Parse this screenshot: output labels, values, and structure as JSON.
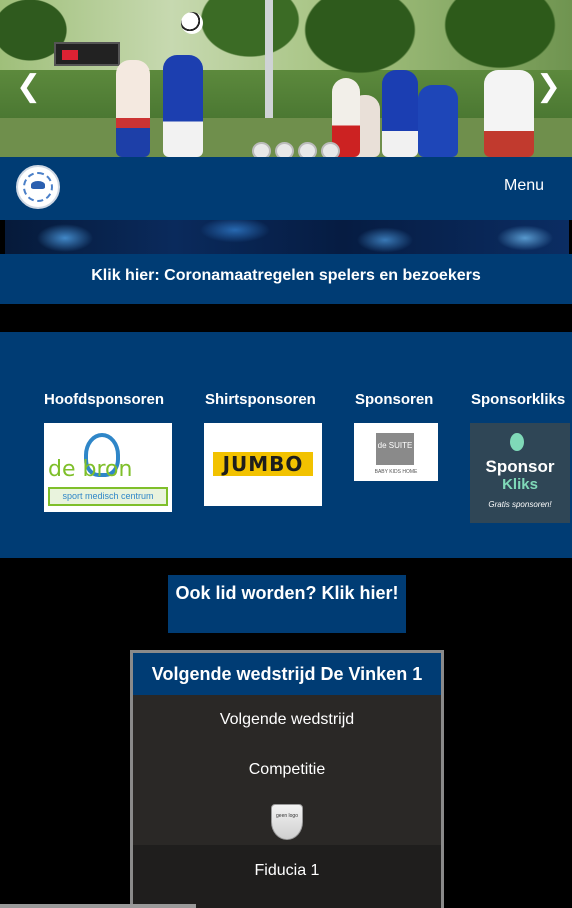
{
  "slider": {
    "prev_icon": "chevron-left-icon",
    "next_icon": "chevron-right-icon",
    "prev_glyph": "❮",
    "next_glyph": "❯",
    "dots_count": 4
  },
  "nav": {
    "menu_label": "Menu"
  },
  "banner": {
    "corona_link": "Klik hier: Coronamaatregelen spelers en bezoekers"
  },
  "sponsors": {
    "headings": [
      "Hoofdsponsoren",
      "Shirtsponsoren",
      "Sponsoren",
      "Sponsorkliks"
    ],
    "logos": {
      "bron_word": "de bron",
      "bron_tagline": "sport medisch centrum",
      "jumbo": "JUMBO",
      "suite_word": "de SUITE",
      "suite_caption": "BABY KIDS HOME",
      "kliks_line1": "Sponsor",
      "kliks_line2": "Kliks",
      "kliks_line3": "Gratis sponsoren!"
    }
  },
  "cta": {
    "label": "Ook lid worden? Klik hier!"
  },
  "match": {
    "header": "Volgende wedstrijd De Vinken 1",
    "next_label": "Volgende wedstrijd",
    "competition": "Competitie",
    "logo_text": "geen logo",
    "opponent": "Fiducia 1"
  },
  "colors": {
    "brand_blue": "#003c74",
    "background": "#000000"
  }
}
